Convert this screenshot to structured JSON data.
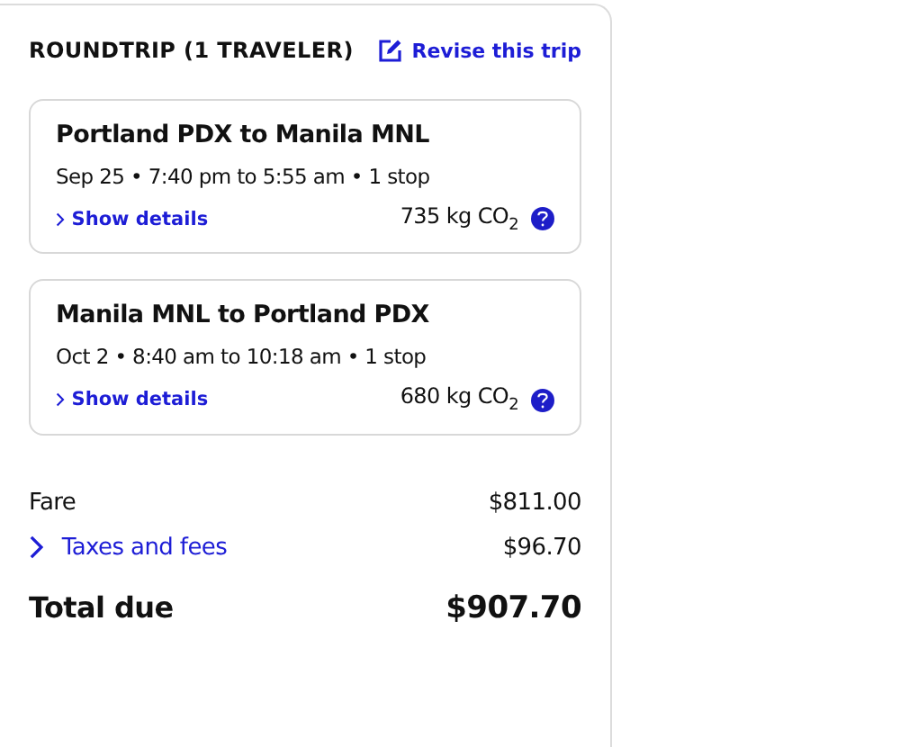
{
  "summary": {
    "title": "ROUNDTRIP (1 TRAVELER)",
    "revise_link": "Revise this trip"
  },
  "flights": [
    {
      "route": "Portland PDX to Manila MNL",
      "schedule": "Sep 25 • 7:40 pm to 5:55 am • 1 stop",
      "details_link": "Show details",
      "emissions": "735 kg CO$_{2}$"
    },
    {
      "route": "Manila MNL to Portland PDX",
      "schedule": "Oct 2 • 8:40 am to 10:18 am • 1 stop",
      "details_link": "Show details",
      "emissions": "680 kg CO$_{2}$"
    }
  ],
  "price_lines": [
    {
      "kind": "plain",
      "label": "Fare",
      "amount": "$811.00"
    },
    {
      "kind": "expandable",
      "label": "Taxes and fees",
      "amount": "$96.70"
    },
    {
      "kind": "total",
      "label": "Total due",
      "amount": "$907.70"
    }
  ]
}
